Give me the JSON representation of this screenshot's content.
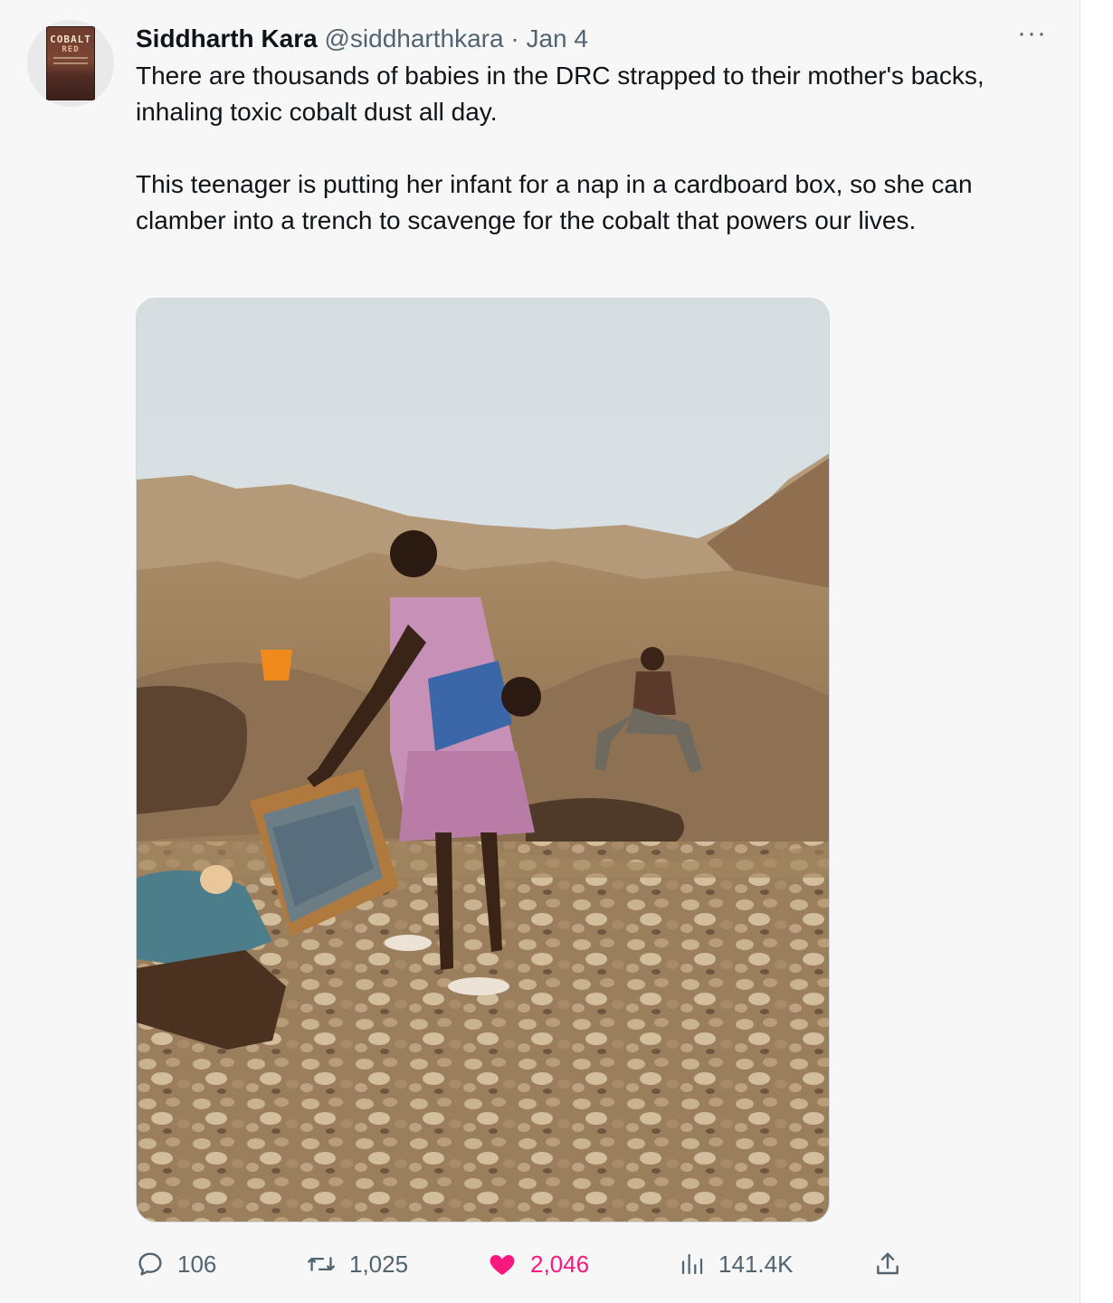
{
  "tweet": {
    "author_name": "Siddharth Kara",
    "author_handle": "@siddharthkara",
    "separator": " · ",
    "date": "Jan 4",
    "more_label": "···",
    "text_paragraph_1": "There are thousands of babies in the DRC strapped to their mother's backs, inhaling toxic cobalt dust all day.",
    "text_paragraph_2": "This teenager is putting her infant for a nap in a cardboard box, so she can clamber into a trench to scavenge for the cobalt that powers our lives.",
    "avatar": {
      "book_title_1": "COBALT",
      "book_title_2": "RED"
    },
    "actions": {
      "replies": "106",
      "retweets": "1,025",
      "likes": "2,046",
      "views": "141.4K"
    },
    "colors": {
      "like": "#f91880",
      "secondary_text": "#536471"
    }
  }
}
